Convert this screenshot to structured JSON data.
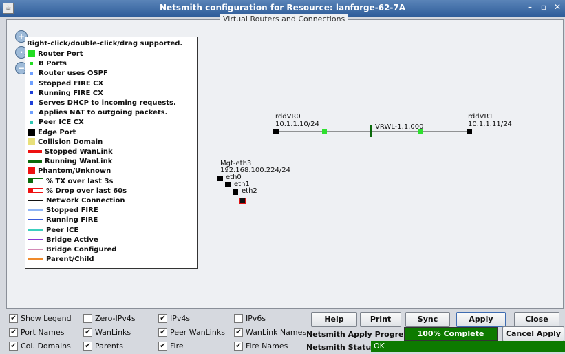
{
  "window": {
    "title": "Netsmith configuration for Resource:  lanforge-62-7A",
    "min": "–",
    "max": "▫",
    "close": "✕"
  },
  "panel": {
    "title": "Virtual Routers and Connections"
  },
  "legend": {
    "header": "Right-click/double-click/drag supported.",
    "items": [
      {
        "label": "Router Port",
        "color": "#22dd22"
      },
      {
        "label": "B Ports",
        "color": "#22dd22"
      },
      {
        "label": "Router uses OSPF",
        "color": "#6fa0ff"
      },
      {
        "label": "Stopped FIRE CX",
        "color": "#6fa0ff"
      },
      {
        "label": "Running FIRE CX",
        "color": "#1d3fd8"
      },
      {
        "label": "Serves DHCP to incoming requests.",
        "color": "#1d3fd8"
      },
      {
        "label": "Applies NAT to outgoing packets.",
        "color": "#6fa0ff"
      },
      {
        "label": "Peer ICE CX",
        "color": "#2ec7b3"
      },
      {
        "label": "Edge Port",
        "color": "#000000"
      },
      {
        "label": "Collision Domain",
        "color": "#e8e07a"
      },
      {
        "label": "Stopped WanLink",
        "color": "#ee1111"
      },
      {
        "label": "Running WanLink",
        "color": "#0b6a0b"
      },
      {
        "label": "Phantom/Unknown",
        "color": "#ee1111"
      },
      {
        "label": "% TX over last 3s",
        "color": "#0b6a0b"
      },
      {
        "label": "% Drop over last 60s",
        "color": "#ee1111"
      },
      {
        "label": "Network Connection",
        "color": "#111111"
      },
      {
        "label": "Stopped FIRE",
        "color": "#8fb5f5"
      },
      {
        "label": "Running FIRE",
        "color": "#3a5bd9"
      },
      {
        "label": "Peer ICE",
        "color": "#3ccfbf"
      },
      {
        "label": "Bridge Active",
        "color": "#8a37d6"
      },
      {
        "label": "Bridge Configured",
        "color": "#d48ab7"
      },
      {
        "label": "Parent/Child",
        "color": "#f08a2a"
      }
    ]
  },
  "topology": {
    "vr0": {
      "name": "rddVR0",
      "ip": "10.1.1.10/24"
    },
    "vr1": {
      "name": "rddVR1",
      "ip": "10.1.1.11/24"
    },
    "wanlink": "VRWL-1.1.000",
    "mgt": {
      "name": "Mgt-eth3",
      "ip": "192.168.100.224/24"
    },
    "ports": [
      "eth0",
      "eth1",
      "eth2"
    ]
  },
  "controls": {
    "checkboxes": [
      {
        "label": "Show Legend",
        "checked": true
      },
      {
        "label": "Zero-IPv4s",
        "checked": false
      },
      {
        "label": "IPv4s",
        "checked": true
      },
      {
        "label": "IPv6s",
        "checked": false
      },
      {
        "label": "Port Names",
        "checked": true
      },
      {
        "label": "WanLinks",
        "checked": true
      },
      {
        "label": "Peer WanLinks",
        "checked": true
      },
      {
        "label": "WanLink Names",
        "checked": true
      },
      {
        "label": "Col. Domains",
        "checked": true
      },
      {
        "label": "Parents",
        "checked": true
      },
      {
        "label": "Fire",
        "checked": true
      },
      {
        "label": "Fire Names",
        "checked": true
      }
    ],
    "buttons": {
      "help": "Help",
      "print": "Print",
      "sync": "Sync",
      "apply": "Apply",
      "close": "Close",
      "cancel_apply": "Cancel Apply"
    },
    "progress_label": "Netsmith Apply Progress:",
    "progress_text": "100% Complete",
    "progress_value": 1.0,
    "status_label": "Netsmith Status:",
    "status_text": "OK"
  }
}
